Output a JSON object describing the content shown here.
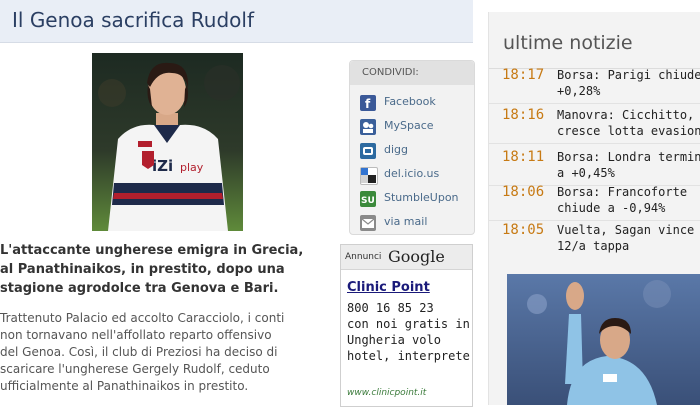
{
  "header": {
    "title": "Il Genoa sacrifica Rudolf"
  },
  "share": {
    "heading": "CONDIVIDI:",
    "items": [
      {
        "label": "Facebook",
        "icon": "facebook-icon"
      },
      {
        "label": "MySpace",
        "icon": "myspace-icon"
      },
      {
        "label": "digg",
        "icon": "digg-icon"
      },
      {
        "label": "del.icio.us",
        "icon": "delicious-icon"
      },
      {
        "label": "StumbleUpon",
        "icon": "stumbleupon-icon"
      },
      {
        "label": "via mail",
        "icon": "mail-icon"
      }
    ]
  },
  "article": {
    "lead_lines": [
      "L'attaccante ungherese emigra in Grecia,",
      "al Panathinaikos, in prestito, dopo una",
      "stagione agrodolce tra Genova e Bari."
    ],
    "body_lines": [
      "Trattenuto Palacio ed accolto Caracciolo, i conti",
      "non tornavano nell'affollato reparto offensivo",
      "del Genoa. Così, il club di Preziosi ha deciso di",
      "scaricare l'ungherese Gergely Rudolf, ceduto",
      "ufficialmente al Panathinaikos in prestito."
    ]
  },
  "ad": {
    "label": "Annunci",
    "brand": "Google",
    "title": "Clinic Point",
    "lines": [
      "800 16 85 23",
      "con noi gratis in",
      "Ungheria volo",
      "hotel, interprete"
    ],
    "url": "www.clinicpoint.it"
  },
  "news": {
    "title": "ultime notizie",
    "items": [
      {
        "time": "18:17",
        "lines": [
          "Borsa: Parigi chiude a",
          "+0,28%"
        ]
      },
      {
        "time": "18:16",
        "lines": [
          "Manovra: Cicchitto,",
          "cresce lotta evasione"
        ]
      },
      {
        "time": "18:11",
        "lines": [
          "Borsa: Londra termina",
          "a +0,45%"
        ]
      },
      {
        "time": "18:06",
        "lines": [
          "Borsa: Francoforte",
          "chiude a -0,94%"
        ]
      },
      {
        "time": "18:05",
        "lines": [
          "Vuelta, Sagan vince la",
          "12/a tappa"
        ]
      }
    ]
  },
  "colors": {
    "header_bg": "#e9eef6",
    "title_color": "#2b3f63",
    "time_color": "#c77a14",
    "jersey_red": "#b21f2d",
    "jersey_navy": "#1e2a4a",
    "lazio_blue": "#8fc3e6"
  }
}
